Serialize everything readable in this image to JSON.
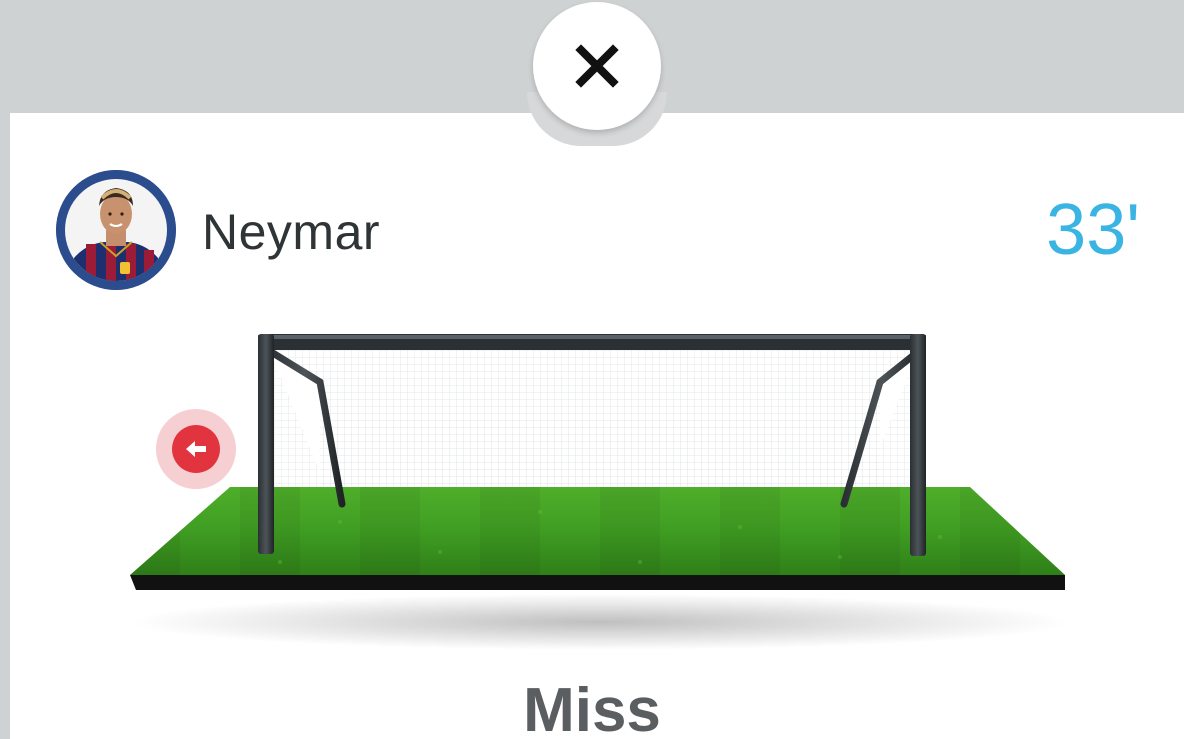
{
  "header": {
    "close_icon": "close-x-icon"
  },
  "event": {
    "player_name": "Neymar",
    "minute": "33'",
    "result": "Miss",
    "direction_icon": "arrow-left-icon"
  },
  "colors": {
    "minute": "#3ab4e3",
    "miss_indicator": "#e2343e",
    "miss_indicator_halo": "#f6cfd2",
    "avatar_ring": "#2d4e8e",
    "result_text": "#5b5e60"
  }
}
